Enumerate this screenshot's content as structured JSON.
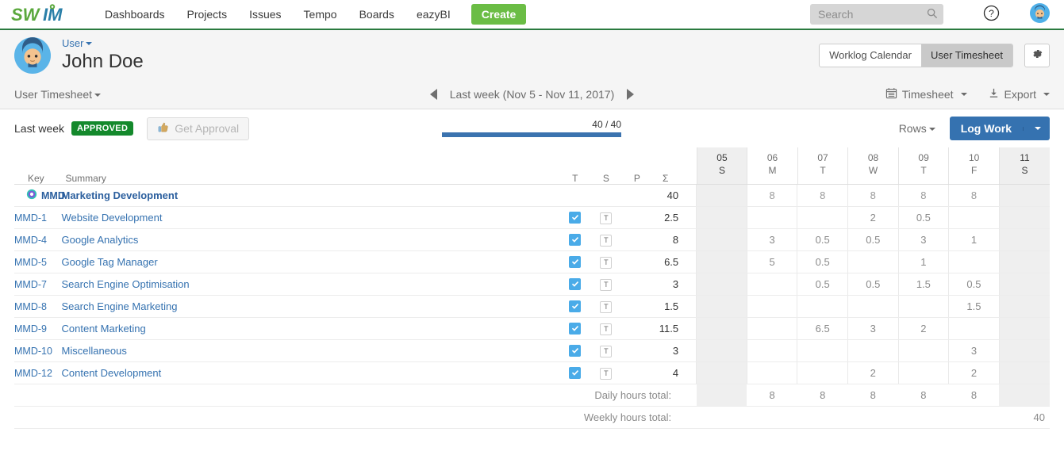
{
  "topnav": {
    "logo_text": "SWIM",
    "items": [
      {
        "label": "Dashboards"
      },
      {
        "label": "Projects"
      },
      {
        "label": "Issues"
      },
      {
        "label": "Tempo"
      },
      {
        "label": "Boards"
      },
      {
        "label": "eazyBI"
      }
    ],
    "create_label": "Create",
    "search_placeholder": "Search",
    "search_value": "",
    "icons": {
      "search": "search-icon",
      "help": "help-icon",
      "avatar": "avatar"
    },
    "colors": {
      "create_green": "#6bbd45",
      "border_green": "#2a7a3f",
      "link_blue": "#3572b0"
    }
  },
  "userheader": {
    "user_link": "User",
    "user_name": "John Doe",
    "view_tabs": [
      {
        "label": "Worklog Calendar",
        "active": false
      },
      {
        "label": "User Timesheet",
        "active": true
      }
    ],
    "settings_icon": "gear-icon"
  },
  "subtoolbar": {
    "title": "User Timesheet",
    "prev_icon": "chevron-left-icon",
    "next_icon": "chevron-right-icon",
    "period_label": "Last week (Nov 5 - Nov 11, 2017)",
    "timesheet_label": "Timesheet",
    "timesheet_icon": "calendar-icon",
    "export_label": "Export",
    "export_icon": "download-icon"
  },
  "approval": {
    "period_label": "Last week",
    "status_badge": "APPROVED",
    "status_color": "#14892c",
    "get_approval_label": "Get Approval",
    "get_approval_icon": "thumbs-up-icon",
    "progress_label": "40 / 40",
    "progress_percent": 100,
    "progress_color": "#3b73af",
    "rows_label": "Rows",
    "log_work_label": "Log Work"
  },
  "table": {
    "headers": {
      "key": "Key",
      "summary": "Summary",
      "t": "T",
      "s": "S",
      "p": "P",
      "sigma": "Σ"
    },
    "days": [
      {
        "num": "05",
        "letter": "S",
        "weekend": true
      },
      {
        "num": "06",
        "letter": "M",
        "weekend": false
      },
      {
        "num": "07",
        "letter": "T",
        "weekend": false
      },
      {
        "num": "08",
        "letter": "W",
        "weekend": false
      },
      {
        "num": "09",
        "letter": "T",
        "weekend": false
      },
      {
        "num": "10",
        "letter": "F",
        "weekend": false
      },
      {
        "num": "11",
        "letter": "S",
        "weekend": true
      }
    ],
    "rows": [
      {
        "group": true,
        "icon": "project-icon",
        "key": "MMD",
        "summary": "Marketing Development",
        "checkbox": false,
        "t_badge": false,
        "total": "40",
        "days": [
          "",
          "8",
          "8",
          "8",
          "8",
          "8",
          ""
        ]
      },
      {
        "group": false,
        "key": "MMD-1",
        "summary": "Website Development",
        "checkbox": true,
        "t_badge": "T",
        "total": "2.5",
        "days": [
          "",
          "",
          "",
          "2",
          "0.5",
          "",
          ""
        ]
      },
      {
        "group": false,
        "key": "MMD-4",
        "summary": "Google Analytics",
        "checkbox": true,
        "t_badge": "T",
        "total": "8",
        "days": [
          "",
          "3",
          "0.5",
          "0.5",
          "3",
          "1",
          ""
        ]
      },
      {
        "group": false,
        "key": "MMD-5",
        "summary": "Google Tag Manager",
        "checkbox": true,
        "t_badge": "T",
        "total": "6.5",
        "days": [
          "",
          "5",
          "0.5",
          "",
          "1",
          "",
          ""
        ]
      },
      {
        "group": false,
        "key": "MMD-7",
        "summary": "Search Engine Optimisation",
        "checkbox": true,
        "t_badge": "T",
        "total": "3",
        "days": [
          "",
          "",
          "0.5",
          "0.5",
          "1.5",
          "0.5",
          ""
        ]
      },
      {
        "group": false,
        "key": "MMD-8",
        "summary": "Search Engine Marketing",
        "checkbox": true,
        "t_badge": "T",
        "total": "1.5",
        "days": [
          "",
          "",
          "",
          "",
          "",
          "1.5",
          ""
        ]
      },
      {
        "group": false,
        "key": "MMD-9",
        "summary": "Content Marketing",
        "checkbox": true,
        "t_badge": "T",
        "total": "11.5",
        "days": [
          "",
          "",
          "6.5",
          "3",
          "2",
          "",
          ""
        ]
      },
      {
        "group": false,
        "key": "MMD-10",
        "summary": "Miscellaneous",
        "checkbox": true,
        "t_badge": "T",
        "total": "3",
        "days": [
          "",
          "",
          "",
          "",
          "",
          "3",
          ""
        ]
      },
      {
        "group": false,
        "key": "MMD-12",
        "summary": "Content Development",
        "checkbox": true,
        "t_badge": "T",
        "total": "4",
        "days": [
          "",
          "",
          "",
          "2",
          "",
          "2",
          ""
        ]
      }
    ],
    "footer": {
      "daily_label": "Daily hours total:",
      "daily_values": [
        "",
        "8",
        "8",
        "8",
        "8",
        "8",
        ""
      ],
      "weekly_label": "Weekly hours total:",
      "weekly_total": "40"
    }
  }
}
